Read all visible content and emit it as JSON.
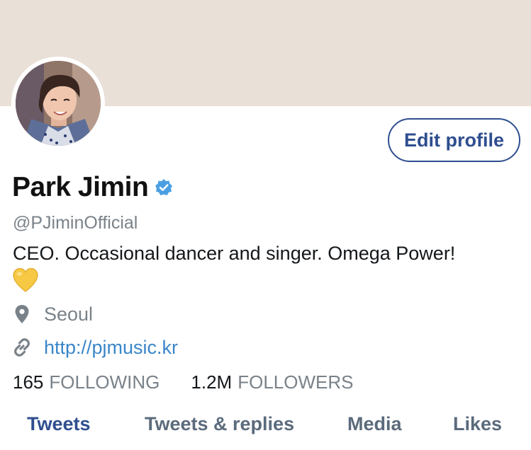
{
  "header": {
    "banner_color": "#e9e0d8"
  },
  "profile": {
    "avatar_icon": "profile-photo",
    "edit_label": "Edit profile",
    "display_name": "Park Jimin",
    "verified": true,
    "handle": "@PJiminOfficial",
    "bio": "CEO. Occasional dancer and singer. Omega Power!",
    "bio_emoji": "yellow-heart",
    "location": "Seoul",
    "website": "http://pjmusic.kr"
  },
  "stats": {
    "following_count": "165",
    "following_label": "FOLLOWING",
    "followers_count": "1.2M",
    "followers_label": "FOLLOWERS"
  },
  "tabs": [
    {
      "label": "Tweets",
      "active": true
    },
    {
      "label": "Tweets & replies",
      "active": false
    },
    {
      "label": "Media",
      "active": false
    },
    {
      "label": "Likes",
      "active": false
    }
  ],
  "colors": {
    "accent": "#2f4e8f",
    "link": "#3a86c9",
    "verified": "#4a9fe3",
    "muted": "#7a8289"
  }
}
